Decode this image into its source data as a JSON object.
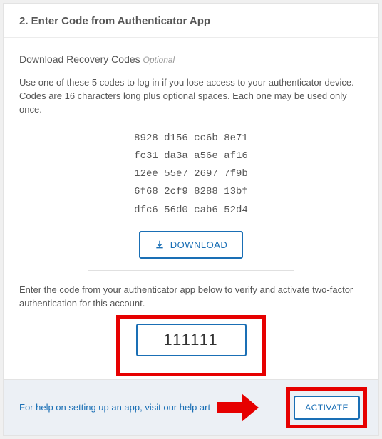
{
  "header": {
    "step_title": "2. Enter Code from Authenticator App"
  },
  "recovery": {
    "title": "Download Recovery Codes",
    "optional_label": "Optional",
    "description": "Use one of these 5 codes to log in if you lose access to your authenticator device. Codes are 16 characters long plus optional spaces. Each one may be used only once.",
    "codes": [
      "8928 d156 cc6b 8e71",
      "fc31 da3a a56e af16",
      "12ee 55e7 2697 7f9b",
      "6f68 2cf9 8288 13bf",
      "dfc6 56d0 cab6 52d4"
    ],
    "download_label": "DOWNLOAD"
  },
  "verify": {
    "instruction": "Enter the code from your authenticator app below to verify and activate two-factor authentication for this account.",
    "code_value": "111111"
  },
  "footer": {
    "help_text": "For help on setting up an app, visit our help art",
    "activate_label": "ACTIVATE"
  },
  "colors": {
    "accent": "#1a6fb5",
    "highlight": "#e60000"
  }
}
